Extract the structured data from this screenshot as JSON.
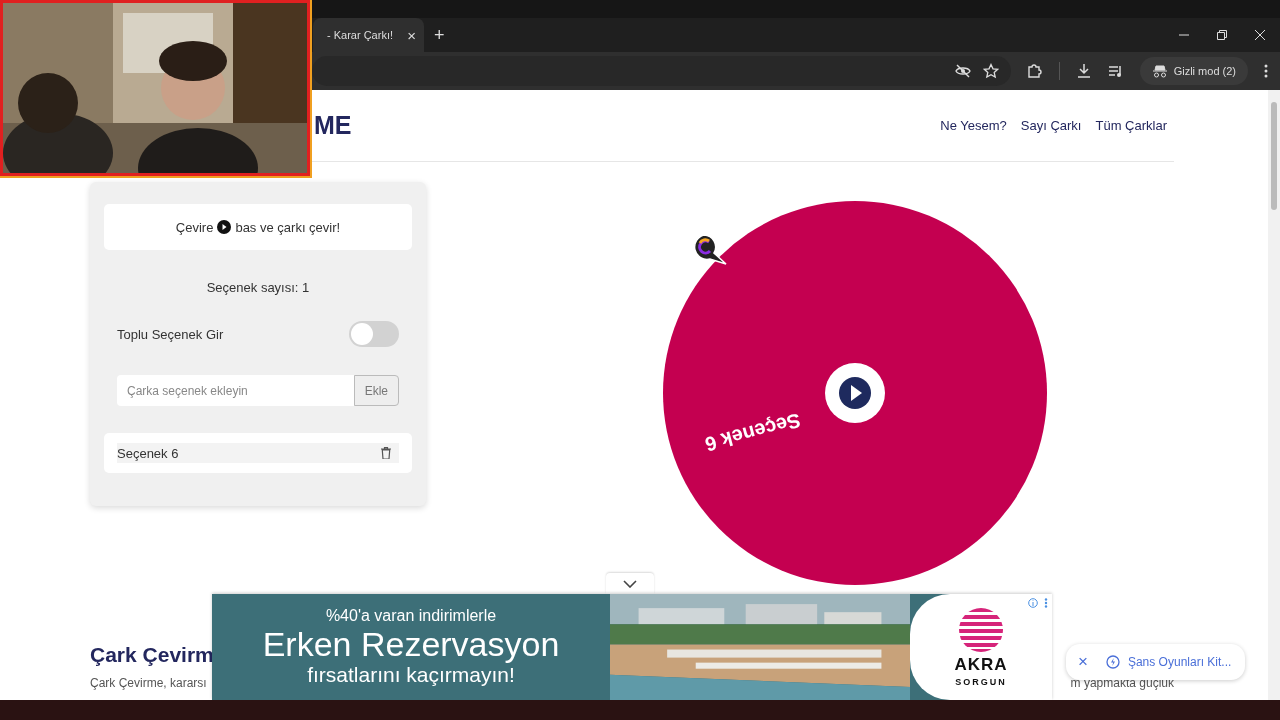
{
  "browser": {
    "tab_title": "- Karar Çarkı!",
    "tab_close": "×",
    "new_tab": "+",
    "incognito": "Gizli mod (2)"
  },
  "header": {
    "logo": "ME",
    "nav": [
      {
        "label": "Ne Yesem?"
      },
      {
        "label": "Sayı Çarkı"
      },
      {
        "label": "Tüm Çarklar"
      }
    ]
  },
  "panel": {
    "hint_before": "Çevire",
    "hint_after": "bas ve çarkı çevir!",
    "count": "Seçenek sayısı: 1",
    "bulk": {
      "label": "Toplu Seçenek Gir",
      "on": false
    },
    "input": {
      "placeholder": "Çarka seçenek ekleyin",
      "button": "Ekle"
    },
    "options": [
      {
        "label": "Seçenek 6"
      }
    ]
  },
  "wheel": {
    "segments": [
      {
        "label": "Seçenek 6",
        "color": "#c40050"
      }
    ]
  },
  "article": {
    "heading": "Çark Çevirm",
    "text": "Çark Çevirme, kararsı",
    "text_right": "m yapmakta güçlük"
  },
  "ad": {
    "line1": "%40'a varan indirimlerle",
    "line2": "Erken Rezervasyon",
    "line3": "fırsatlarını kaçırmayın!",
    "brand": "AKRA",
    "brand_sub": "SORGUN"
  },
  "chip": {
    "close": "×",
    "label": "Şans Oyunları Kit..."
  }
}
